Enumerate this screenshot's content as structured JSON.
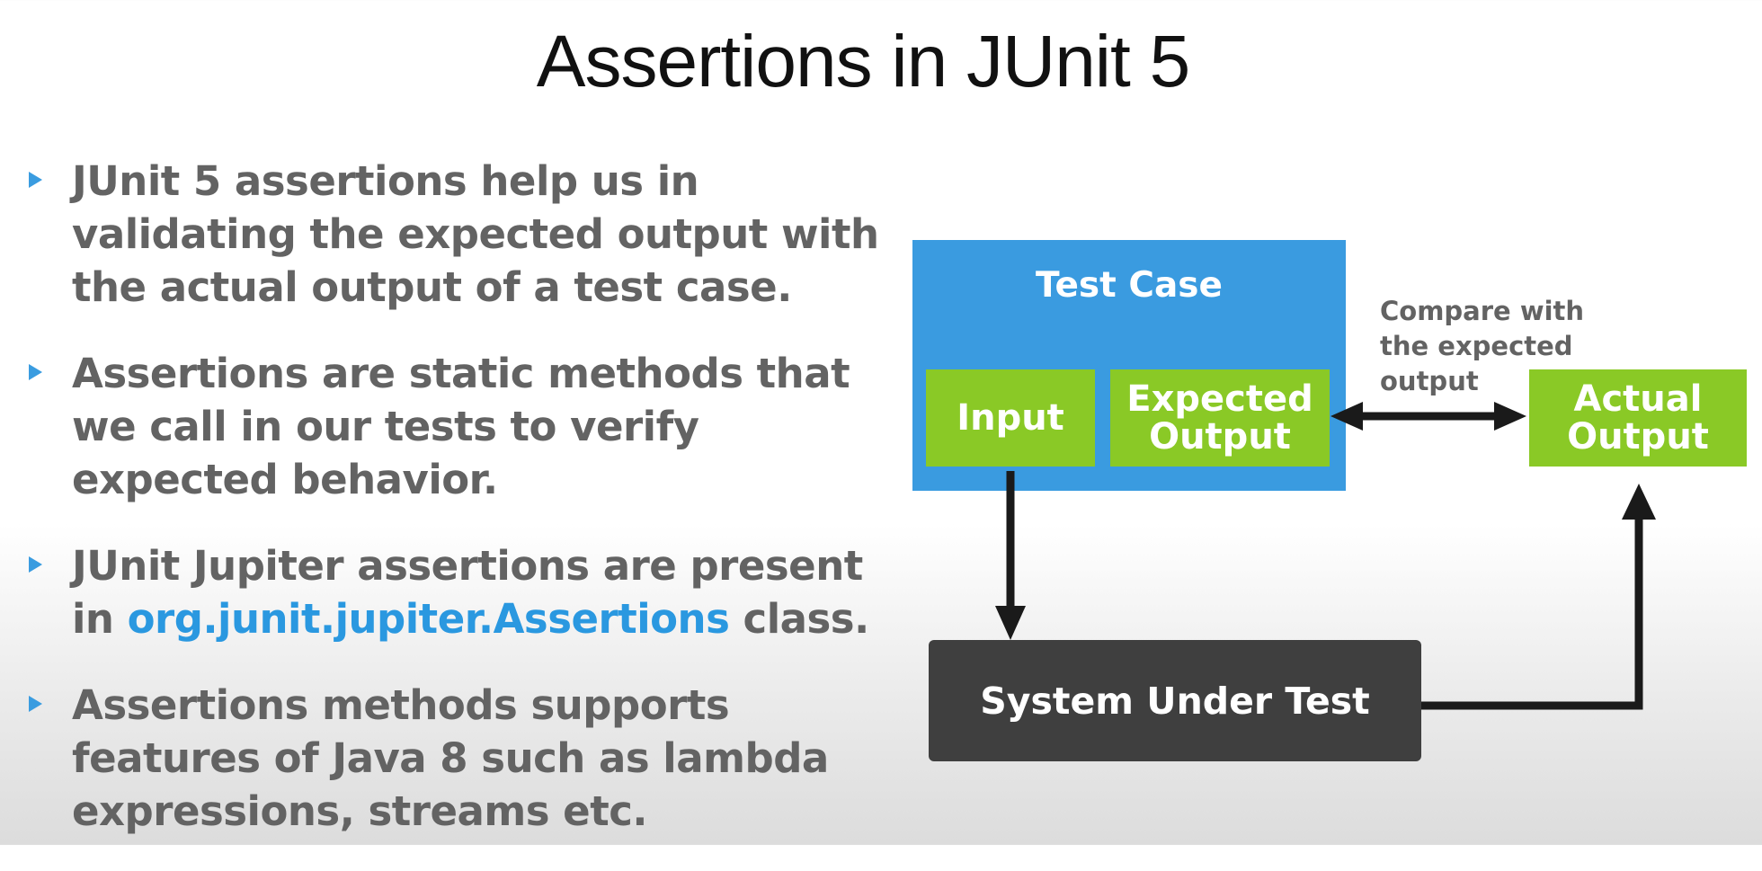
{
  "slide": {
    "title": "Assertions in JUnit 5"
  },
  "bullets": [
    {
      "text": "JUnit 5 assertions help us in validating the expected output with the actual output of a test case."
    },
    {
      "text": "Assertions are static methods that we call in our tests to verify expected behavior."
    },
    {
      "before": "JUnit Jupiter assertions are present in ",
      "code": "org.junit.jupiter.Assertions",
      "after": " class."
    },
    {
      "text": "Assertions methods supports features of Java 8 such as lambda expressions, streams etc."
    }
  ],
  "diagram": {
    "test_case_label": "Test Case",
    "input_label": "Input",
    "expected_output_label": "Expected Output",
    "actual_output_label": "Actual Output",
    "compare_label": "Compare with the expected output",
    "system_under_test_label": "System Under Test"
  },
  "colors": {
    "accent_blue": "#3a9be0",
    "box_green": "#8ac926",
    "sut_dark": "#3f3f3f",
    "body_text": "#636363",
    "link_blue": "#2a98e0"
  }
}
